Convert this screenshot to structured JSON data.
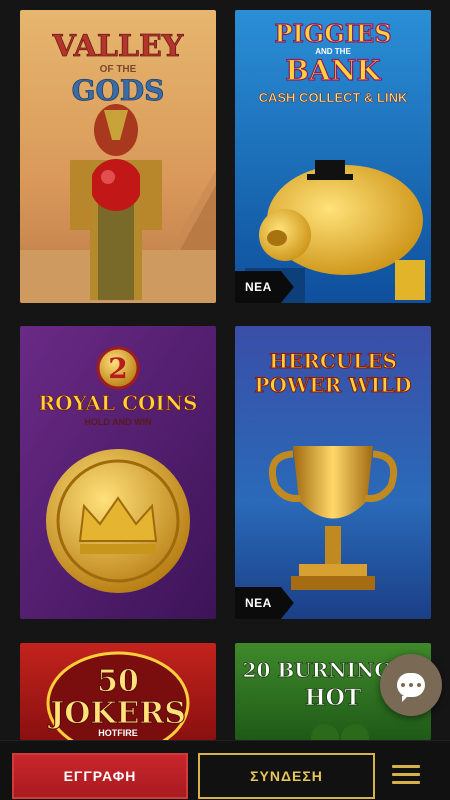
{
  "games": [
    {
      "title_line1": "VALLEY",
      "title_line2": "OF THE",
      "title_line3": "GODS",
      "badge": ""
    },
    {
      "title_line1": "PIGGIES",
      "title_line2": "AND THE",
      "title_line3": "BANK",
      "subtitle": "CASH COLLECT & LINK",
      "badge": "NEA"
    },
    {
      "title_line1": "2",
      "title_line2": "ROYAL COINS",
      "title_line3": "HOLD AND WIN",
      "badge": ""
    },
    {
      "title_line1": "HERCULES",
      "title_line2": "POWER WILD",
      "badge": "NEA"
    },
    {
      "title_line1": "50",
      "title_line2": "JOKERS",
      "title_line3": "HOTFIRE",
      "badge": ""
    },
    {
      "title_line1": "20 BURNING",
      "title_line2": "HOT",
      "badge": ""
    }
  ],
  "bottom_bar": {
    "register_label": "ΕΓΓΡΑΦΗ",
    "login_label": "ΣΥΝΔΕΣΗ"
  },
  "colors": {
    "register_red": "#c8262b",
    "login_gold": "#d6b24a",
    "background": "#151515"
  }
}
